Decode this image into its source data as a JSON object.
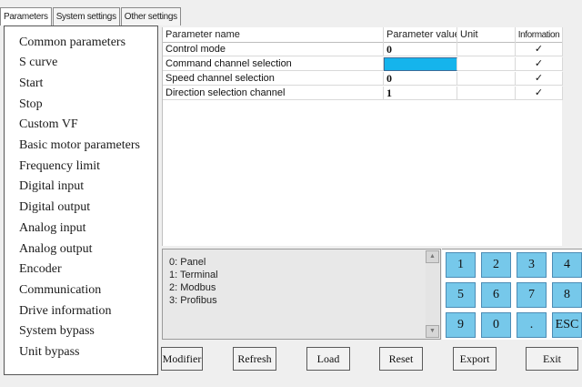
{
  "tabs": [
    "Parameters",
    "System settings",
    "Other settings"
  ],
  "menu": [
    "Common parameters",
    "S curve",
    "Start",
    "Stop",
    "Custom VF",
    "Basic motor parameters",
    "Frequency limit",
    "Digital input",
    "Digital output",
    "Analog input",
    "Analog output",
    "Encoder",
    "Communication",
    "Drive information",
    "System bypass",
    "Unit bypass"
  ],
  "table": {
    "headers": {
      "name": "Parameter name",
      "value": "Parameter value",
      "unit": "Unit",
      "info": "Information"
    },
    "rows": [
      {
        "name": "Control mode",
        "value": "0",
        "unit": "",
        "info": "✓"
      },
      {
        "name": "Command channel selection",
        "value": "",
        "unit": "",
        "info": "✓"
      },
      {
        "name": "Speed channel selection",
        "value": "0",
        "unit": "",
        "info": "✓"
      },
      {
        "name": "Direction selection channel",
        "value": "1",
        "unit": "",
        "info": "✓"
      }
    ]
  },
  "info_lines": [
    "0: Panel",
    "1: Terminal",
    "2: Modbus",
    "3: Profibus"
  ],
  "keypad": [
    "1",
    "2",
    "3",
    "4",
    "5",
    "6",
    "7",
    "8",
    "9",
    "0",
    ".",
    "ESC"
  ],
  "buttons": [
    "Modifier",
    "Refresh",
    "Load",
    "Reset",
    "Export",
    "Exit"
  ],
  "colors": {
    "selected_value": "#15b4ec",
    "key": "#76c8ea"
  }
}
